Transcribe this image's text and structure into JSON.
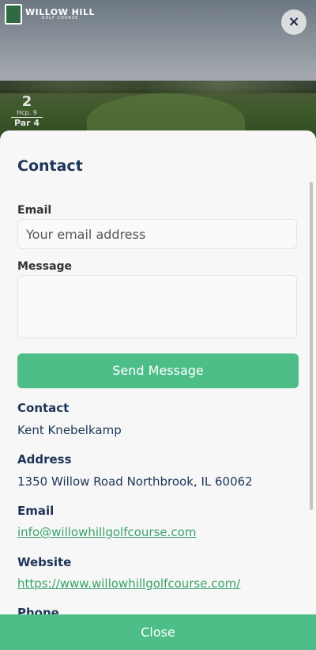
{
  "header": {
    "logo_line1": "WILLOW HILL",
    "logo_line2": "GOLF COURSE",
    "close_icon": "×",
    "hole_number": "2",
    "handicap": "Hcp. 9",
    "par": "Par 4"
  },
  "form": {
    "title": "Contact",
    "email_label": "Email",
    "email_placeholder": "Your email address",
    "message_label": "Message",
    "send_label": "Send Message"
  },
  "info": {
    "contact_heading": "Contact",
    "contact_value": "Kent Knebelkamp",
    "address_heading": "Address",
    "address_value": "1350 Willow Road Northbrook, IL 60062",
    "email_heading": "Email",
    "email_value": "info@willowhillgolfcourse.com",
    "website_heading": "Website",
    "website_value": "https://www.willowhillgolfcourse.com/",
    "phone_heading": "Phone"
  },
  "footer": {
    "close_label": "Close"
  },
  "colors": {
    "accent": "#4dbe88",
    "navy": "#1d3557",
    "link": "#3aa36a"
  }
}
